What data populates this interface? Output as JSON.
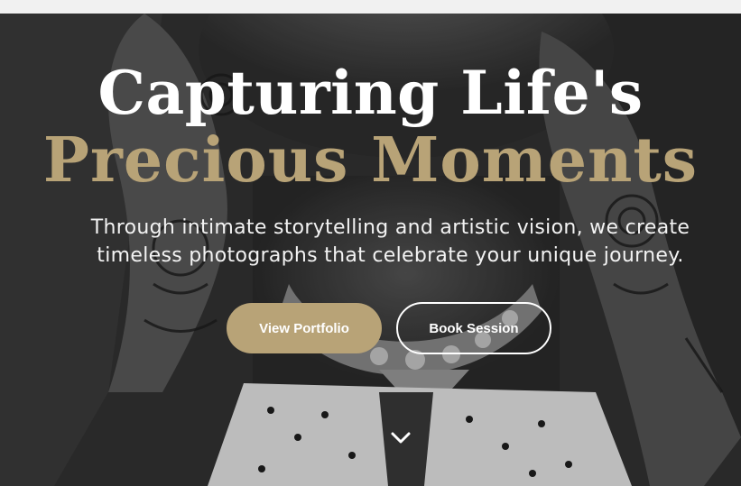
{
  "hero": {
    "title_line1": "Capturing Life's",
    "title_line2": "Precious Moments",
    "subtitle": "Through intimate storytelling and artistic vision, we create timeless photographs that celebrate your unique journey."
  },
  "buttons": {
    "primary_label": "View Portfolio",
    "secondary_label": "Book Session"
  },
  "icons": {
    "scroll": "chevron-down-icon"
  },
  "colors": {
    "accent": "#b8a377",
    "title_white": "#ffffff",
    "topbar": "#f1f1f1"
  }
}
